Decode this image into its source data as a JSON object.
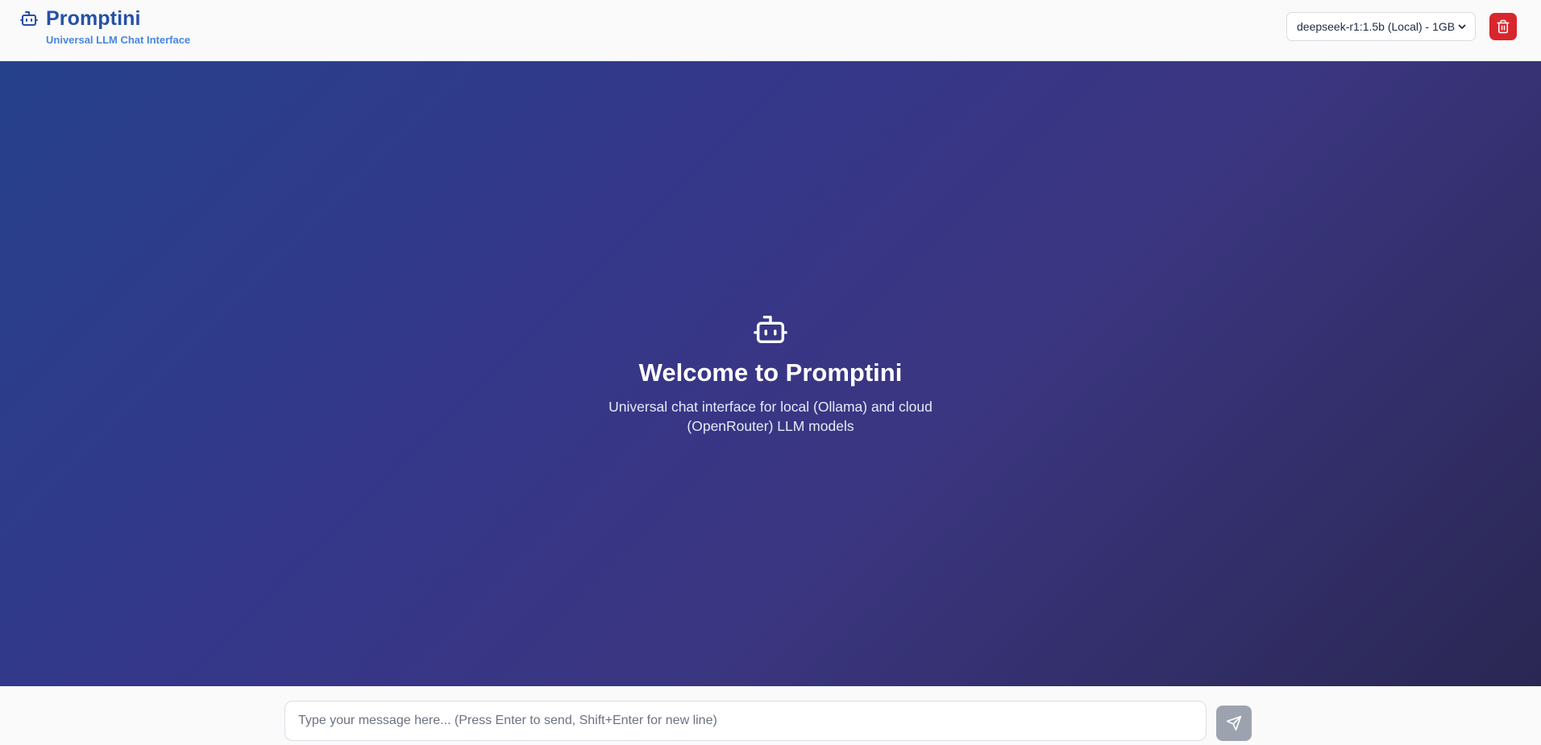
{
  "header": {
    "title": "Promptini",
    "subtitle": "Universal LLM Chat Interface",
    "brand_icon": "bot-icon",
    "model_select": {
      "selected": "deepseek-r1:1.5b (Local) - 1GB",
      "icon": "chevron-down-icon"
    },
    "delete_button": {
      "icon": "trash-icon",
      "color": "#d8262c"
    }
  },
  "welcome": {
    "icon": "bot-icon",
    "title": "Welcome to Promptini",
    "text": "Universal chat interface for local (Ollama) and cloud (OpenRouter) LLM models"
  },
  "composer": {
    "placeholder": "Type your message here... (Press Enter to send, Shift+Enter for new line)",
    "value": "",
    "send_icon": "send-icon"
  },
  "colors": {
    "brand": "#2550a8",
    "subtitle": "#4a86db",
    "hero_gradient_start": "#26418c",
    "hero_gradient_end": "#2a2753",
    "send_disabled": "#9ca3af"
  }
}
